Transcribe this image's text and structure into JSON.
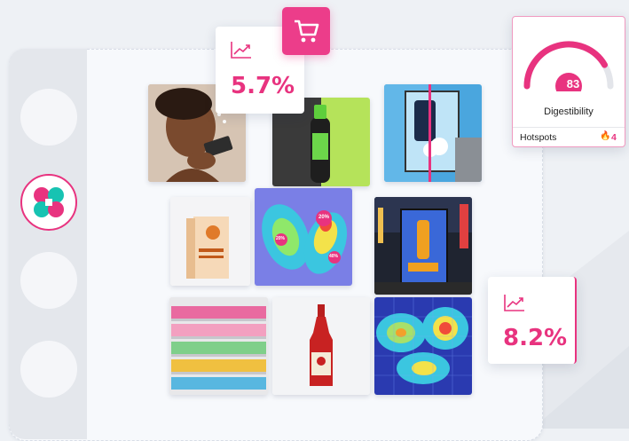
{
  "stats": {
    "top": {
      "value": "5.7%",
      "icon": "trend-up-icon"
    },
    "bottom": {
      "value": "8.2%",
      "icon": "trend-up-icon"
    }
  },
  "digestibility": {
    "score": "83",
    "label": "Digestibility",
    "hotspots_label": "Hotspots",
    "hotspots_count": "4",
    "gauge_fraction": 0.83
  },
  "labels": {
    "heat_left": "20%",
    "heat_right": "40%",
    "heat_small": "20%"
  },
  "colors": {
    "accent": "#e8337f",
    "teal": "#17c3b2",
    "sidebar": "#e4e7ec"
  }
}
